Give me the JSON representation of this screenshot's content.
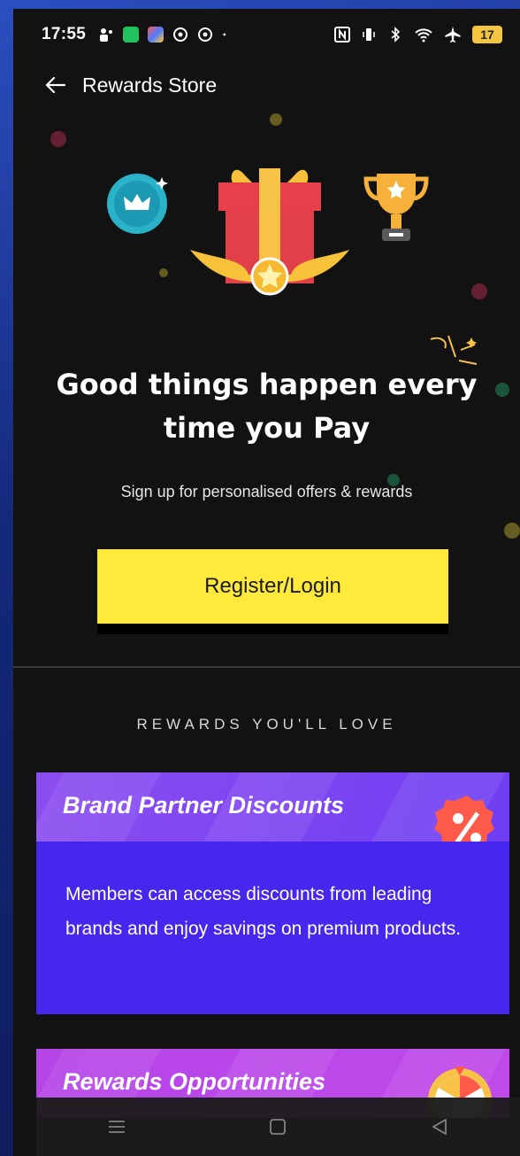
{
  "status_bar": {
    "time": "17:55",
    "battery": "17"
  },
  "header": {
    "title": "Rewards Store"
  },
  "hero": {
    "headline_line1": "Good things happen every",
    "headline_line2": "time you Pay",
    "subtext": "Sign up for personalised offers & rewards",
    "register_label": "Register/Login"
  },
  "rewards": {
    "heading": "REWARDS YOU'LL LOVE",
    "cards": [
      {
        "title": "Brand Partner Discounts",
        "description": "Members can access discounts from leading brands and enjoy savings on premium products."
      },
      {
        "title": "Rewards Opportunities"
      }
    ]
  },
  "colors": {
    "button_yellow": "#ffe93b",
    "card_purple": "#4727ee",
    "background": "#121212"
  }
}
